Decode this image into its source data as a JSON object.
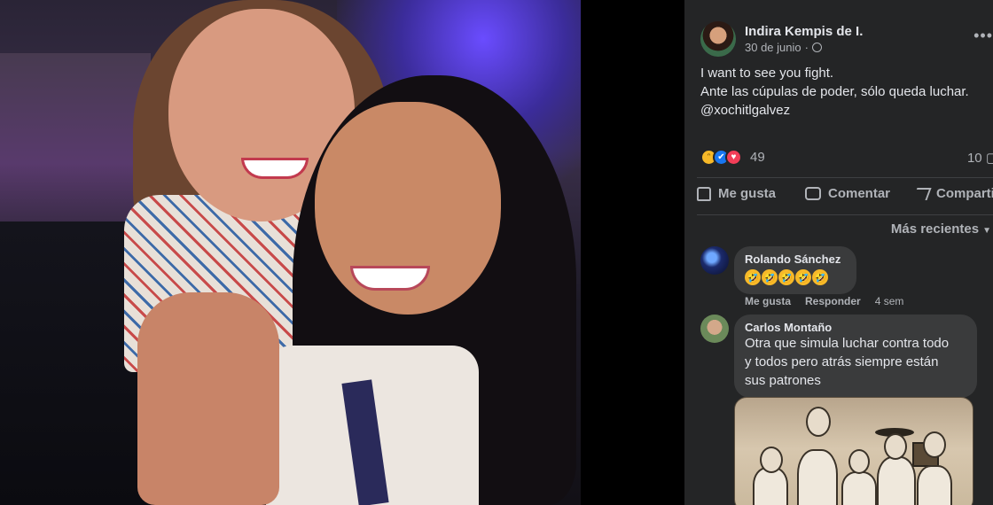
{
  "photo": {
    "alt": "Two smiling women posing together at an event"
  },
  "post": {
    "author": "Indira Kempis de I.",
    "date": "30 de junio",
    "separator": "·",
    "text_lines": [
      "I want to see you fight.",
      "Ante las cúpulas de poder, sólo queda luchar.",
      "@xochitlgalvez"
    ],
    "reaction_count": "49",
    "comment_count": "10",
    "more": "•••"
  },
  "actions": {
    "like": "Me gusta",
    "comment": "Comentar",
    "share": "Compartir"
  },
  "sort": {
    "label": "Más recientes"
  },
  "comments": [
    {
      "name": "Rolando Sánchez",
      "emojis": [
        "🤣",
        "🤣",
        "🤣",
        "🤣",
        "🤣"
      ],
      "like": "Me gusta",
      "reply": "Responder",
      "time": "4 sem"
    },
    {
      "name": "Carlos Montaño",
      "text_lines": [
        "Otra que simula luchar contra todo",
        "y todos pero atrás siempre están",
        "sus patrones"
      ]
    }
  ],
  "colors": {
    "panel_bg": "#242526",
    "bubble_bg": "#3a3b3c",
    "text_primary": "#e4e6eb",
    "text_secondary": "#b0b3b8",
    "like_blue": "#1877f2"
  }
}
